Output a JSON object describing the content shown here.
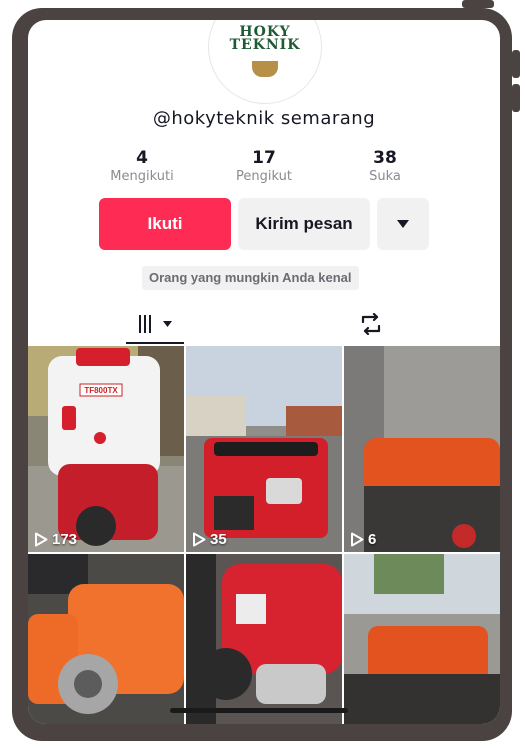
{
  "profile": {
    "brand_line1": "HOKY",
    "brand_line2": "TEKNIK",
    "username": "@hokyteknik semarang"
  },
  "stats": [
    {
      "value": "4",
      "label": "Mengikuti"
    },
    {
      "value": "17",
      "label": "Pengikut"
    },
    {
      "value": "38",
      "label": "Suka"
    }
  ],
  "actions": {
    "follow_label": "Ikuti",
    "message_label": "Kirim pesan",
    "more_icon": "chevron-down-icon"
  },
  "suggestion": "Orang yang mungkin Anda kenal",
  "tabs": {
    "videos_icon": "grid-icon",
    "repost_icon": "repost-icon"
  },
  "videos": [
    {
      "views": "173",
      "label": "TF800TX"
    },
    {
      "views": "35"
    },
    {
      "views": "6"
    },
    {
      "views": ""
    },
    {
      "views": ""
    },
    {
      "views": ""
    }
  ],
  "colors": {
    "follow": "#fe2c55",
    "secondary_button": "#f1f1f2",
    "frame": "#4a4341"
  }
}
